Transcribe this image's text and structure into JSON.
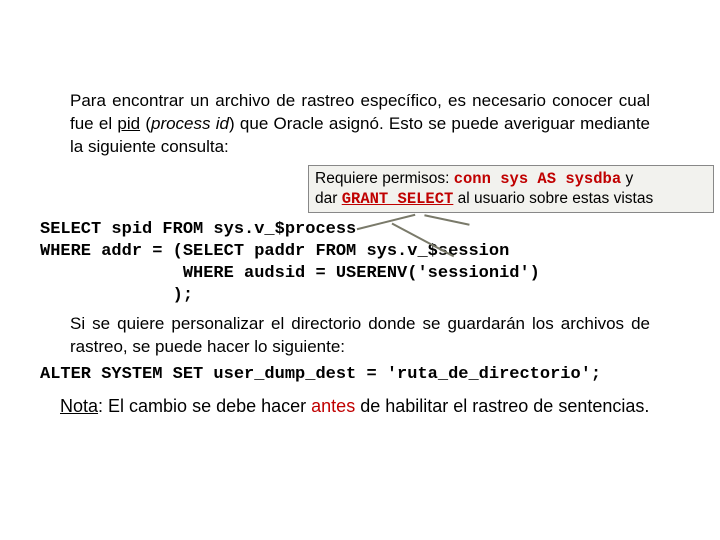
{
  "intro": {
    "t1": "Para encontrar un archivo de rastreo específico, es necesario conocer cual fue el ",
    "pid": "pid",
    "t2": " (",
    "process_id": "process id",
    "t3": ") que Oracle asignó. Esto se puede averiguar mediante la siguiente consulta:"
  },
  "permbox": {
    "pre1": "Requiere permisos: ",
    "conn": "conn sys AS sysdba",
    "y": " y",
    "dar": "dar ",
    "grant": "GRANT SELECT",
    "post": " al usuario sobre estas vistas"
  },
  "sql1": {
    "l1": "SELECT spid FROM sys.v_$process",
    "l2": "WHERE addr = (SELECT paddr FROM sys.v_$session",
    "l3": "              WHERE audsid = USERENV('sessionid')",
    "l4": "             );"
  },
  "mid": "Si se quiere personalizar el directorio donde se guardarán los archivos de rastreo, se puede hacer lo siguiente:",
  "sql2": "ALTER SYSTEM SET user_dump_dest = 'ruta_de_directorio';",
  "note": {
    "n1": "Nota",
    "n2": ": El cambio se debe hacer ",
    "antes": "antes",
    "n3": " de habilitar el rastreo de sentencias."
  }
}
